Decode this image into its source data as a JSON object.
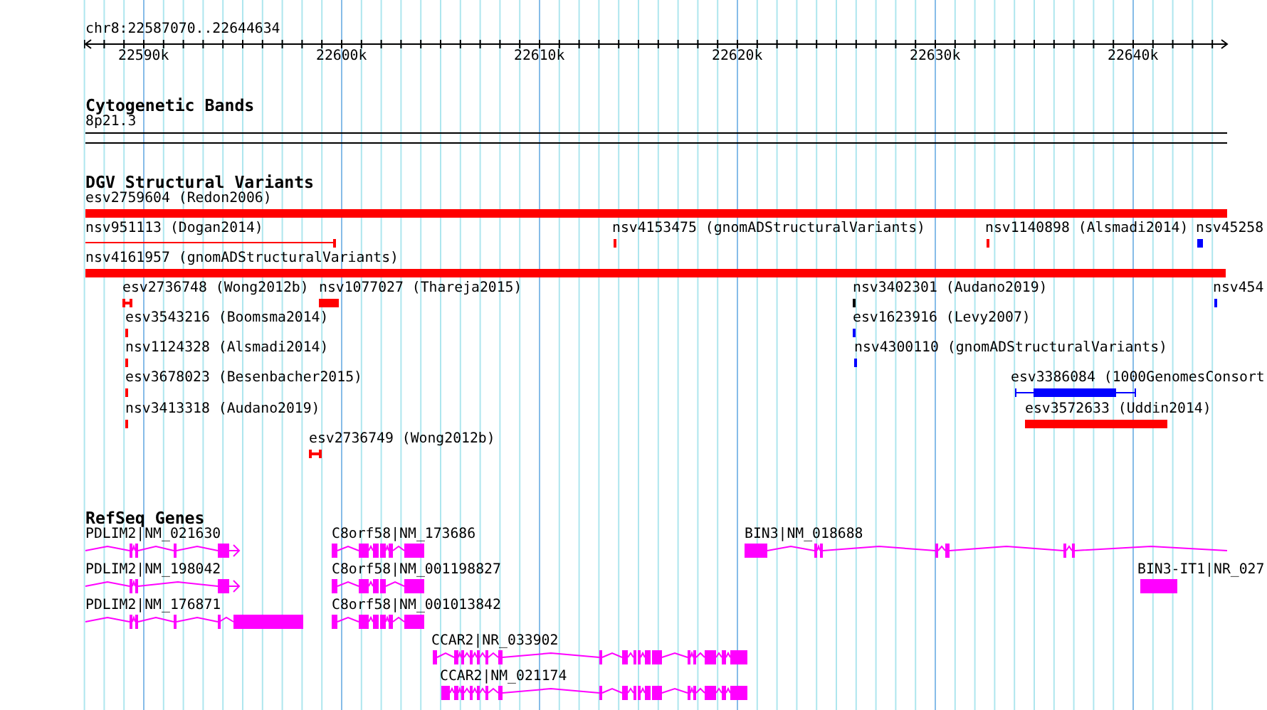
{
  "location": "chr8:22587070..22644634",
  "ruler_ticks": [
    "22590k",
    "22600k",
    "22610k",
    "22620k",
    "22630k",
    "22640k"
  ],
  "cyto_track": {
    "title": "Cytogenetic Bands",
    "bands": [
      {
        "label": "8p21.3"
      }
    ]
  },
  "variant_track": {
    "title": "DGV Structural Variants",
    "features": [
      {
        "label": "esv2759604 (Redon2006)",
        "color": "#ff0000"
      },
      {
        "label": "nsv951113 (Dogan2014)",
        "color": "#ff0000"
      },
      {
        "label": "nsv4153475 (gnomADStructuralVariants)",
        "color": "#ff0000"
      },
      {
        "label": "nsv1140898 (Alsmadi2014)",
        "color": "#ff0000"
      },
      {
        "label": "nsv45258",
        "color": "#0000ff"
      },
      {
        "label": "nsv4161957 (gnomADStructuralVariants)",
        "color": "#ff0000"
      },
      {
        "label": "esv2736748 (Wong2012b)",
        "color": "#ff0000"
      },
      {
        "label": "nsv1077027 (Thareja2015)",
        "color": "#ff0000"
      },
      {
        "label": "nsv3402301 (Audano2019)",
        "color": "#000000"
      },
      {
        "label": "nsv454",
        "color": "#0000ff"
      },
      {
        "label": "esv3543216 (Boomsma2014)",
        "color": "#ff0000"
      },
      {
        "label": "esv1623916 (Levy2007)",
        "color": "#0000ff"
      },
      {
        "label": "nsv1124328 (Alsmadi2014)",
        "color": "#ff0000"
      },
      {
        "label": "nsv4300110 (gnomADStructuralVariants)",
        "color": "#0000ff"
      },
      {
        "label": "esv3678023 (Besenbacher2015)",
        "color": "#ff0000"
      },
      {
        "label": "esv3386084 (1000GenomesConsort",
        "color": "#0000ff"
      },
      {
        "label": "nsv3413318 (Audano2019)",
        "color": "#ff0000"
      },
      {
        "label": "esv3572633 (Uddin2014)",
        "color": "#ff0000"
      },
      {
        "label": "esv2736749 (Wong2012b)",
        "color": "#ff0000"
      }
    ]
  },
  "gene_track": {
    "title": "RefSeq Genes",
    "genes": [
      {
        "label": "PDLIM2|NM_021630"
      },
      {
        "label": "PDLIM2|NM_198042"
      },
      {
        "label": "PDLIM2|NM_176871"
      },
      {
        "label": "C8orf58|NM_173686"
      },
      {
        "label": "C8orf58|NM_001198827"
      },
      {
        "label": "C8orf58|NM_001013842"
      },
      {
        "label": "CCAR2|NR_033902"
      },
      {
        "label": "CCAR2|NM_021174"
      },
      {
        "label": "BIN3|NM_018688"
      },
      {
        "label": "BIN3-IT1|NR_027"
      }
    ]
  }
}
